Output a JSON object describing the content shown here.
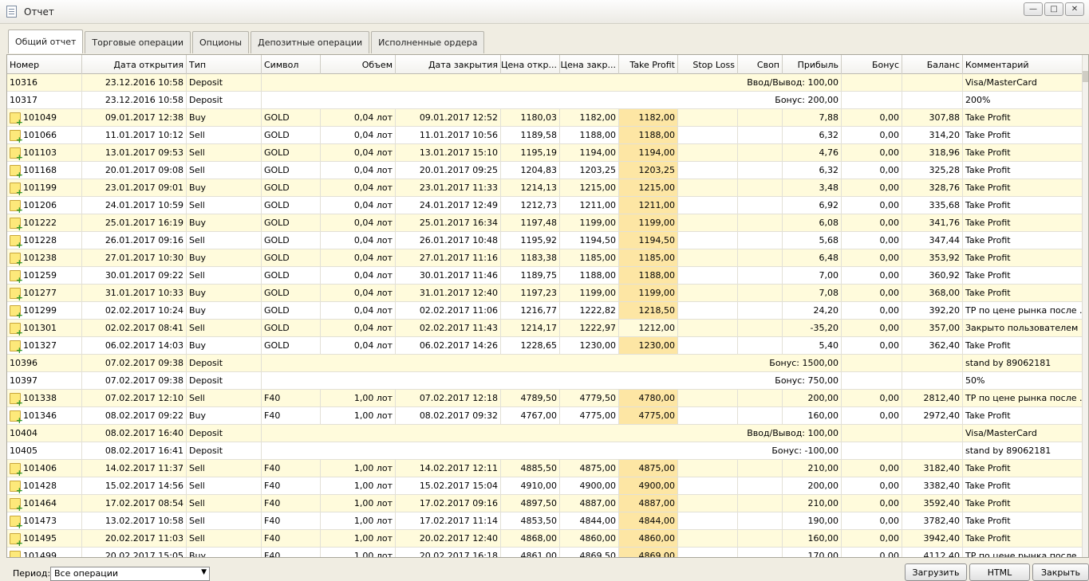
{
  "window": {
    "title": "Отчет"
  },
  "tabs": [
    "Общий отчет",
    "Торговые операции",
    "Опционы",
    "Депозитные операции",
    "Исполненные ордера"
  ],
  "columns": [
    "Номер",
    "Дата открытия",
    "Тип",
    "Символ",
    "Объем",
    "Дата закрытия",
    "Цена откр...",
    "Цена закр...",
    "Take Profit",
    "Stop Loss",
    "Своп",
    "Прибыль",
    "Бонус",
    "Баланс",
    "Комментарий"
  ],
  "rows": [
    {
      "id": "10316",
      "open": "23.12.2016 10:58",
      "type": "Deposit",
      "summary": "Ввод/Вывод: 100,00",
      "comment": "Visa/MasterCard"
    },
    {
      "id": "10317",
      "open": "23.12.2016 10:58",
      "type": "Deposit",
      "summary": "Бонус: 200,00",
      "comment": "200%"
    },
    {
      "id": "101049",
      "open": "09.01.2017 12:38",
      "type": "Buy",
      "symbol": "GOLD",
      "volume": "0,04 лот",
      "close": "09.01.2017 12:52",
      "open_price": "1180,03",
      "close_price": "1182,00",
      "tp": "1182,00",
      "tp_hl": true,
      "profit": "7,88",
      "bonus": "0,00",
      "balance": "307,88",
      "comment": "Take Profit"
    },
    {
      "id": "101066",
      "open": "11.01.2017 10:12",
      "type": "Sell",
      "symbol": "GOLD",
      "volume": "0,04 лот",
      "close": "11.01.2017 10:56",
      "open_price": "1189,58",
      "close_price": "1188,00",
      "tp": "1188,00",
      "tp_hl": true,
      "profit": "6,32",
      "bonus": "0,00",
      "balance": "314,20",
      "comment": "Take Profit"
    },
    {
      "id": "101103",
      "open": "13.01.2017 09:53",
      "type": "Sell",
      "symbol": "GOLD",
      "volume": "0,04 лот",
      "close": "13.01.2017 15:10",
      "open_price": "1195,19",
      "close_price": "1194,00",
      "tp": "1194,00",
      "tp_hl": true,
      "profit": "4,76",
      "bonus": "0,00",
      "balance": "318,96",
      "comment": "Take Profit"
    },
    {
      "id": "101168",
      "open": "20.01.2017 09:08",
      "type": "Sell",
      "symbol": "GOLD",
      "volume": "0,04 лот",
      "close": "20.01.2017 09:25",
      "open_price": "1204,83",
      "close_price": "1203,25",
      "tp": "1203,25",
      "tp_hl": true,
      "profit": "6,32",
      "bonus": "0,00",
      "balance": "325,28",
      "comment": "Take Profit"
    },
    {
      "id": "101199",
      "open": "23.01.2017 09:01",
      "type": "Buy",
      "symbol": "GOLD",
      "volume": "0,04 лот",
      "close": "23.01.2017 11:33",
      "open_price": "1214,13",
      "close_price": "1215,00",
      "tp": "1215,00",
      "tp_hl": true,
      "profit": "3,48",
      "bonus": "0,00",
      "balance": "328,76",
      "comment": "Take Profit"
    },
    {
      "id": "101206",
      "open": "24.01.2017 10:59",
      "type": "Sell",
      "symbol": "GOLD",
      "volume": "0,04 лот",
      "close": "24.01.2017 12:49",
      "open_price": "1212,73",
      "close_price": "1211,00",
      "tp": "1211,00",
      "tp_hl": true,
      "profit": "6,92",
      "bonus": "0,00",
      "balance": "335,68",
      "comment": "Take Profit"
    },
    {
      "id": "101222",
      "open": "25.01.2017 16:19",
      "type": "Buy",
      "symbol": "GOLD",
      "volume": "0,04 лот",
      "close": "25.01.2017 16:34",
      "open_price": "1197,48",
      "close_price": "1199,00",
      "tp": "1199,00",
      "tp_hl": true,
      "profit": "6,08",
      "bonus": "0,00",
      "balance": "341,76",
      "comment": "Take Profit"
    },
    {
      "id": "101228",
      "open": "26.01.2017 09:16",
      "type": "Sell",
      "symbol": "GOLD",
      "volume": "0,04 лот",
      "close": "26.01.2017 10:48",
      "open_price": "1195,92",
      "close_price": "1194,50",
      "tp": "1194,50",
      "tp_hl": true,
      "profit": "5,68",
      "bonus": "0,00",
      "balance": "347,44",
      "comment": "Take Profit"
    },
    {
      "id": "101238",
      "open": "27.01.2017 10:30",
      "type": "Buy",
      "symbol": "GOLD",
      "volume": "0,04 лот",
      "close": "27.01.2017 11:16",
      "open_price": "1183,38",
      "close_price": "1185,00",
      "tp": "1185,00",
      "tp_hl": true,
      "profit": "6,48",
      "bonus": "0,00",
      "balance": "353,92",
      "comment": "Take Profit"
    },
    {
      "id": "101259",
      "open": "30.01.2017 09:22",
      "type": "Sell",
      "symbol": "GOLD",
      "volume": "0,04 лот",
      "close": "30.01.2017 11:46",
      "open_price": "1189,75",
      "close_price": "1188,00",
      "tp": "1188,00",
      "tp_hl": true,
      "profit": "7,00",
      "bonus": "0,00",
      "balance": "360,92",
      "comment": "Take Profit"
    },
    {
      "id": "101277",
      "open": "31.01.2017 10:33",
      "type": "Buy",
      "symbol": "GOLD",
      "volume": "0,04 лот",
      "close": "31.01.2017 12:40",
      "open_price": "1197,23",
      "close_price": "1199,00",
      "tp": "1199,00",
      "tp_hl": true,
      "profit": "7,08",
      "bonus": "0,00",
      "balance": "368,00",
      "comment": "Take Profit"
    },
    {
      "id": "101299",
      "open": "02.02.2017 10:24",
      "type": "Buy",
      "symbol": "GOLD",
      "volume": "0,04 лот",
      "close": "02.02.2017 11:06",
      "open_price": "1216,77",
      "close_price": "1222,82",
      "tp": "1218,50",
      "tp_hl": true,
      "profit": "24,20",
      "bonus": "0,00",
      "balance": "392,20",
      "comment": "TP по цене рынка после ..."
    },
    {
      "id": "101301",
      "open": "02.02.2017 08:41",
      "type": "Sell",
      "symbol": "GOLD",
      "volume": "0,04 лот",
      "close": "02.02.2017 11:43",
      "open_price": "1214,17",
      "close_price": "1222,97",
      "tp": "1212,00",
      "tp_hl": false,
      "profit": "-35,20",
      "bonus": "0,00",
      "balance": "357,00",
      "comment": "Закрыто пользователем"
    },
    {
      "id": "101327",
      "open": "06.02.2017 14:03",
      "type": "Buy",
      "symbol": "GOLD",
      "volume": "0,04 лот",
      "close": "06.02.2017 14:26",
      "open_price": "1228,65",
      "close_price": "1230,00",
      "tp": "1230,00",
      "tp_hl": true,
      "profit": "5,40",
      "bonus": "0,00",
      "balance": "362,40",
      "comment": "Take Profit"
    },
    {
      "id": "10396",
      "open": "07.02.2017 09:38",
      "type": "Deposit",
      "summary": "Бонус: 1500,00",
      "comment": "stand by 89062181"
    },
    {
      "id": "10397",
      "open": "07.02.2017 09:38",
      "type": "Deposit",
      "summary": "Бонус: 750,00",
      "comment": "50%"
    },
    {
      "id": "101338",
      "open": "07.02.2017 12:10",
      "type": "Sell",
      "symbol": "F40",
      "volume": "1,00 лот",
      "close": "07.02.2017 12:18",
      "open_price": "4789,50",
      "close_price": "4779,50",
      "tp": "4780,00",
      "tp_hl": true,
      "profit": "200,00",
      "bonus": "0,00",
      "balance": "2812,40",
      "comment": "TP по цене рынка после ..."
    },
    {
      "id": "101346",
      "open": "08.02.2017 09:22",
      "type": "Buy",
      "symbol": "F40",
      "volume": "1,00 лот",
      "close": "08.02.2017 09:32",
      "open_price": "4767,00",
      "close_price": "4775,00",
      "tp": "4775,00",
      "tp_hl": true,
      "profit": "160,00",
      "bonus": "0,00",
      "balance": "2972,40",
      "comment": "Take Profit"
    },
    {
      "id": "10404",
      "open": "08.02.2017 16:40",
      "type": "Deposit",
      "summary": "Ввод/Вывод: 100,00",
      "comment": "Visa/MasterCard"
    },
    {
      "id": "10405",
      "open": "08.02.2017 16:41",
      "type": "Deposit",
      "summary": "Бонус: -100,00",
      "comment": "stand by 89062181"
    },
    {
      "id": "101406",
      "open": "14.02.2017 11:37",
      "type": "Sell",
      "symbol": "F40",
      "volume": "1,00 лот",
      "close": "14.02.2017 12:11",
      "open_price": "4885,50",
      "close_price": "4875,00",
      "tp": "4875,00",
      "tp_hl": true,
      "profit": "210,00",
      "bonus": "0,00",
      "balance": "3182,40",
      "comment": "Take Profit"
    },
    {
      "id": "101428",
      "open": "15.02.2017 14:56",
      "type": "Sell",
      "symbol": "F40",
      "volume": "1,00 лот",
      "close": "15.02.2017 15:04",
      "open_price": "4910,00",
      "close_price": "4900,00",
      "tp": "4900,00",
      "tp_hl": true,
      "profit": "200,00",
      "bonus": "0,00",
      "balance": "3382,40",
      "comment": "Take Profit"
    },
    {
      "id": "101464",
      "open": "17.02.2017 08:54",
      "type": "Sell",
      "symbol": "F40",
      "volume": "1,00 лот",
      "close": "17.02.2017 09:16",
      "open_price": "4897,50",
      "close_price": "4887,00",
      "tp": "4887,00",
      "tp_hl": true,
      "profit": "210,00",
      "bonus": "0,00",
      "balance": "3592,40",
      "comment": "Take Profit"
    },
    {
      "id": "101473",
      "open": "13.02.2017 10:58",
      "type": "Sell",
      "symbol": "F40",
      "volume": "1,00 лот",
      "close": "17.02.2017 11:14",
      "open_price": "4853,50",
      "close_price": "4844,00",
      "tp": "4844,00",
      "tp_hl": true,
      "profit": "190,00",
      "bonus": "0,00",
      "balance": "3782,40",
      "comment": "Take Profit"
    },
    {
      "id": "101495",
      "open": "20.02.2017 11:03",
      "type": "Sell",
      "symbol": "F40",
      "volume": "1,00 лот",
      "close": "20.02.2017 12:40",
      "open_price": "4868,00",
      "close_price": "4860,00",
      "tp": "4860,00",
      "tp_hl": true,
      "profit": "160,00",
      "bonus": "0,00",
      "balance": "3942,40",
      "comment": "Take Profit"
    },
    {
      "id": "101499",
      "open": "20.02.2017 15:05",
      "type": "Buy",
      "symbol": "F40",
      "volume": "1,00 лот",
      "close": "20.02.2017 16:18",
      "open_price": "4861,00",
      "close_price": "4869,50",
      "tp": "4869,00",
      "tp_hl": true,
      "profit": "170,00",
      "bonus": "0,00",
      "balance": "4112,40",
      "comment": "TP по цене рынка после ..."
    }
  ],
  "footer": {
    "period_label": "Период:",
    "period_value": "Все операции",
    "buttons": [
      "Загрузить",
      "HTML",
      "Закрыть"
    ]
  }
}
